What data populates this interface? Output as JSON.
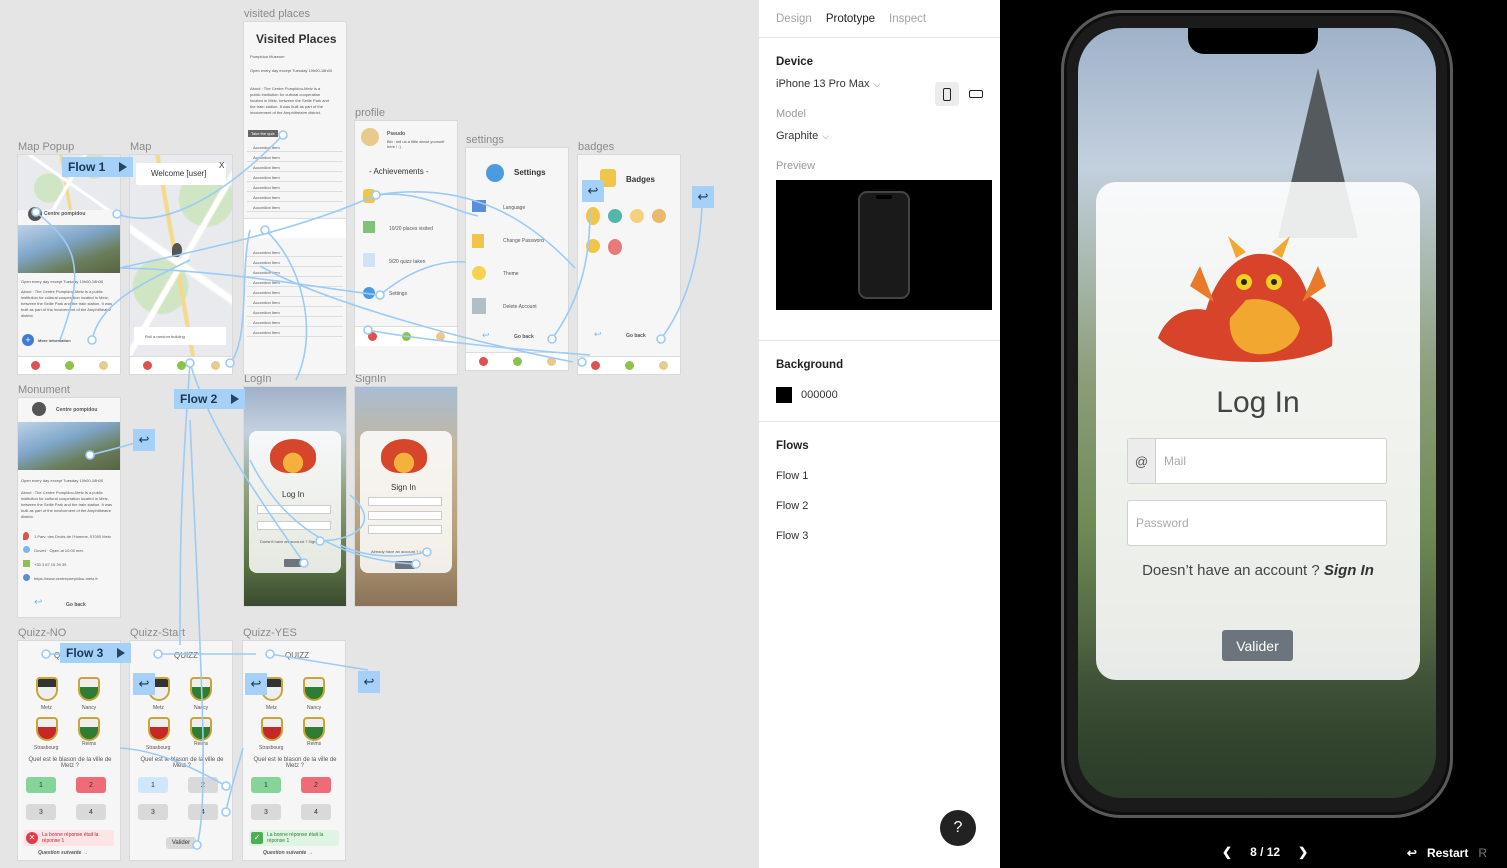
{
  "canvas": {
    "frames": {
      "visited_places": "visited places",
      "profile": "profile",
      "settings": "settings",
      "badges": "badges",
      "map_popup": "Map Popup",
      "map": "Map",
      "monument": "Monument",
      "login": "LogIn",
      "signin": "SignIn",
      "quizz_no": "Quizz-NO",
      "quizz_start": "Quizz-Start",
      "quizz_yes": "Quizz-YES"
    },
    "flows": {
      "flow1": "Flow 1",
      "flow2": "Flow 2",
      "flow3": "Flow 3"
    },
    "visited": {
      "title": "Visited Places",
      "first_item": "Pompidou Museum",
      "open_text": "Open every day except Tuesday 10h00-18h00",
      "about": "About : The Centre Pompidou-Metz is a public institution for cultural cooperation located in Metz, between the Seille Park and the train station. It was built as part of the involvement of the Amphithéatre district.",
      "take_quiz": "Take the quiz",
      "accordion": "Accordion Item"
    },
    "profile": {
      "name": "Pseudo",
      "bio": "Bio : tell us a little about yourself here ! :)",
      "achievements": "- Achievements -",
      "places": "10/20 places visited",
      "quizz": "9/20 quizz taken",
      "settings": "Settings"
    },
    "settings": {
      "title": "Settings",
      "language": "Language",
      "password": "Change Password",
      "theme": "Theme",
      "delete": "Delete Account",
      "go_back": "Go back"
    },
    "badges": {
      "title": "Badges",
      "go_back": "Go back"
    },
    "map_popup": {
      "place": "Centre pompidou",
      "open": "Open every day except Tuesday 10h00-18h00",
      "about": "About : The Centre Pompidou-Metz is a public institution for cultural cooperation located in Metz, between the Seille Park and the train station. It was built as part of the involvement of the Amphithéatre district.",
      "more": "More information"
    },
    "map": {
      "welcome": "Welcome [user]",
      "close": "X",
      "random": "Roll a random building"
    },
    "monument": {
      "place": "Centre pompidou",
      "open": "Open every day except Tuesday 10h00-18h00",
      "about": "About : The Centre Pompidou-Metz is a public institution for cultural cooperation located in Metz, between the Seille Park and the train station. It was built as part of the involvement of the Amphithéatre district.",
      "address": "1 Parv. des Droits de l'Homme, 57000 Metz",
      "hours": "Ouvert · Open at 10:00 mer.",
      "phone": "+33 3 87 15 39 39",
      "site": "https://www.centrepompidou-metz.fr",
      "go_back": "Go back"
    },
    "login_mini": {
      "title": "Log In",
      "dont": "Doesn't have an account ? Sign In"
    },
    "signin_mini": {
      "title": "Sign In",
      "already": "Already have an account ? Log in"
    },
    "quiz": {
      "header": "QUIZZ",
      "cities": [
        "Metz",
        "Nancy",
        "Strasbourg",
        "Reims"
      ],
      "question": "Quel est le blason de la ville de Metz ?",
      "answers": [
        "1",
        "2",
        "3",
        "4"
      ],
      "wrong": "La bonne réponse était la réponse 1",
      "right": "La bonne réponse était la réponse 1",
      "next": "Question suivante →",
      "valider": "Valider"
    }
  },
  "panel": {
    "tabs": [
      "Design",
      "Prototype",
      "Inspect"
    ],
    "active_tab": "Prototype",
    "device_label": "Device",
    "device": "iPhone 13 Pro Max",
    "model_label": "Model",
    "model": "Graphite",
    "preview_label": "Preview",
    "background_label": "Background",
    "background_hex": "000000",
    "background_color": "#000000",
    "flows_label": "Flows",
    "flows": [
      "Flow 1",
      "Flow 2",
      "Flow 3"
    ],
    "help": "?"
  },
  "prototype": {
    "title": "Log In",
    "mail_prefix": "@",
    "mail_placeholder": "Mail",
    "password_placeholder": "Password",
    "no_account": "Doesn’t have an account ?",
    "sign_in": "Sign In",
    "submit": "Valider",
    "page": "8 / 12",
    "restart": "Restart",
    "restart_key": "R"
  },
  "colors": {
    "flow_tag": "#a5d1f8",
    "wire": "#9ccbf5",
    "valider": "#6c757d"
  }
}
